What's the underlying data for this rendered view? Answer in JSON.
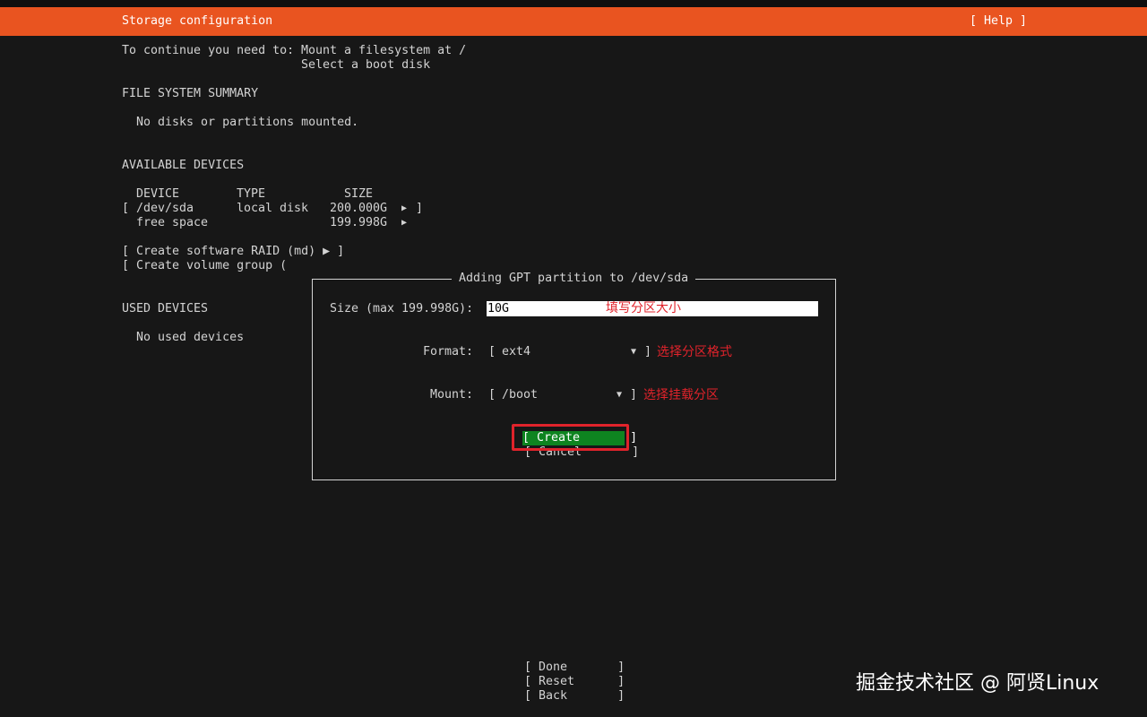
{
  "header": {
    "title": "Storage configuration",
    "help_label": "[ Help ]"
  },
  "intro": {
    "prefix": "To continue you need to:",
    "req1": "Mount a filesystem at /",
    "req2": "Select a boot disk"
  },
  "fs_summary": {
    "heading": "FILE SYSTEM SUMMARY",
    "empty_text": "No disks or partitions mounted."
  },
  "available_devices": {
    "heading": "AVAILABLE DEVICES",
    "columns": [
      "DEVICE",
      "TYPE",
      "SIZE"
    ],
    "rows": [
      {
        "open": "[",
        "device": "/dev/sda",
        "type": "local disk",
        "size": "200.000G",
        "arrow": "▶",
        "close": "]"
      },
      {
        "device": "free space",
        "size": "199.998G",
        "arrow": "▶"
      }
    ],
    "create_raid": "[ Create software RAID (md) ▶ ]",
    "create_vg": "[ Create volume group ("
  },
  "used_devices": {
    "heading": "USED DEVICES",
    "empty_text": "No used devices"
  },
  "dialog": {
    "title": "Adding GPT partition to /dev/sda",
    "size_label": "Size (max 199.998G):",
    "size_value": "10G",
    "format_label": "Format:",
    "format_open": "[",
    "format_value": "ext4",
    "format_arrow": "▼",
    "format_close": "]",
    "mount_label": "Mount:",
    "mount_open": "[",
    "mount_value": "/boot",
    "mount_arrow": "▼",
    "mount_close": "]",
    "create_label": "[ Create       ]",
    "cancel_label": "[ Cancel       ]"
  },
  "annotations": {
    "size_note": "填写分区大小",
    "format_note": "选择分区格式",
    "mount_note": "选择挂载分区"
  },
  "footer": {
    "done": "[ Done       ]",
    "reset": "[ Reset      ]",
    "back": "[ Back       ]"
  },
  "watermark": "掘金技术社区 @ 阿贤Linux",
  "colors": {
    "accent": "#e95420",
    "background": "#171717",
    "create_button": "#0e8420",
    "annotation": "#e0232b"
  }
}
